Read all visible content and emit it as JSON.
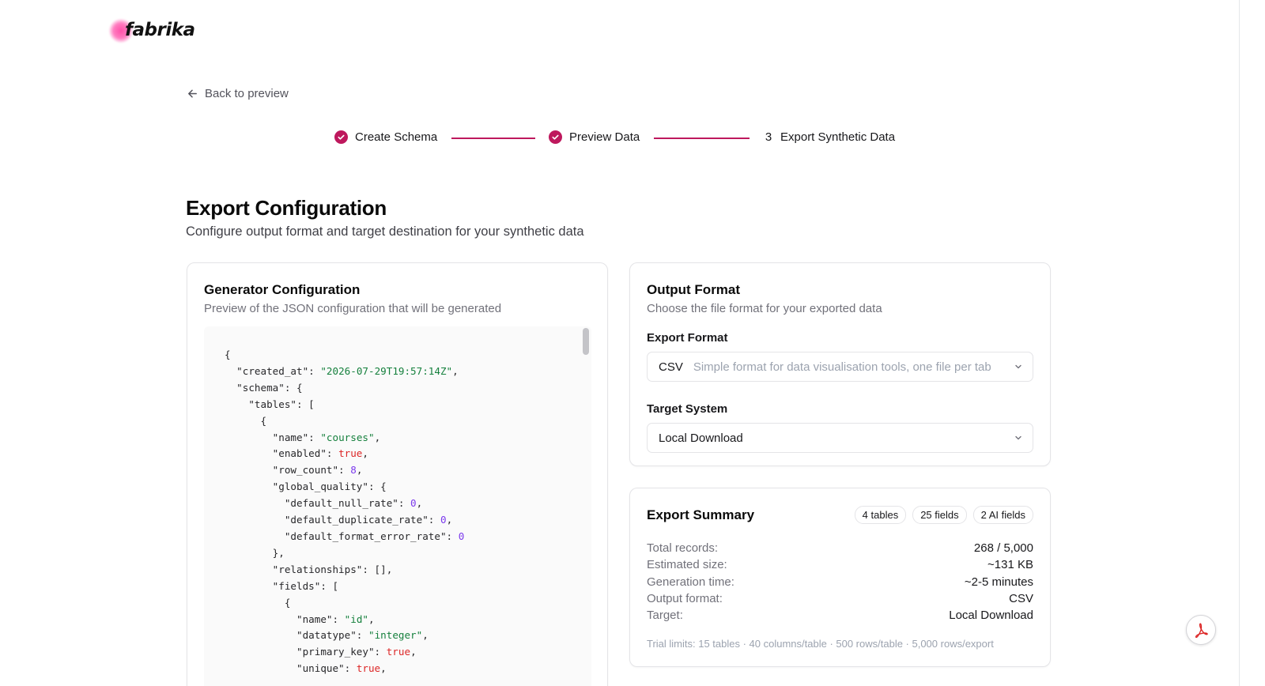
{
  "brand": {
    "name": "fabrika"
  },
  "nav": {
    "back_label": "Back to preview"
  },
  "stepper": {
    "steps": [
      {
        "label": "Create Schema",
        "state": "done"
      },
      {
        "label": "Preview Data",
        "state": "done"
      },
      {
        "number": "3",
        "label": "Export Synthetic Data",
        "state": "current"
      }
    ],
    "accent_color": "#be185d"
  },
  "page": {
    "title": "Export Configuration",
    "subtitle": "Configure output format and target destination for your synthetic data"
  },
  "generator": {
    "title": "Generator Configuration",
    "description": "Preview of the JSON configuration that will be generated",
    "code_lines": [
      "{",
      "  \"created_at\": \"2026-07-29T19:57:14Z\",",
      "  \"schema\": {",
      "    \"tables\": [",
      "      {",
      "        \"name\": \"courses\",",
      "        \"enabled\": true,",
      "        \"row_count\": 8,",
      "        \"global_quality\": {",
      "          \"default_null_rate\": 0,",
      "          \"default_duplicate_rate\": 0,",
      "          \"default_format_error_rate\": 0",
      "        },",
      "        \"relationships\": [],",
      "        \"fields\": [",
      "          {",
      "            \"name\": \"id\",",
      "            \"datatype\": \"integer\",",
      "            \"primary_key\": true,",
      "            \"unique\": true,"
    ]
  },
  "output_format": {
    "title": "Output Format",
    "description": "Choose the file format for your exported data",
    "export_format_label": "Export Format",
    "export_format_value": "CSV",
    "export_format_hint": "Simple format for data visualisation tools, one file per tab",
    "target_system_label": "Target System",
    "target_system_value": "Local Download"
  },
  "summary": {
    "title": "Export Summary",
    "badges": [
      "4 tables",
      "25 fields",
      "2 AI fields"
    ],
    "rows": [
      {
        "key": "Total records:",
        "value": "268 / 5,000"
      },
      {
        "key": "Estimated size:",
        "value": "~131 KB"
      },
      {
        "key": "Generation time:",
        "value": "~2-5 minutes"
      },
      {
        "key": "Output format:",
        "value": "CSV"
      },
      {
        "key": "Target:",
        "value": "Local Download"
      }
    ],
    "trial_note": "Trial limits: 15 tables · 40 columns/table · 500 rows/table · 5,000 rows/export"
  },
  "icons": {
    "back": "arrow-left-icon",
    "step_done": "check-circle-icon",
    "select": "chevron-down-icon",
    "floating": "pdf-icon"
  }
}
